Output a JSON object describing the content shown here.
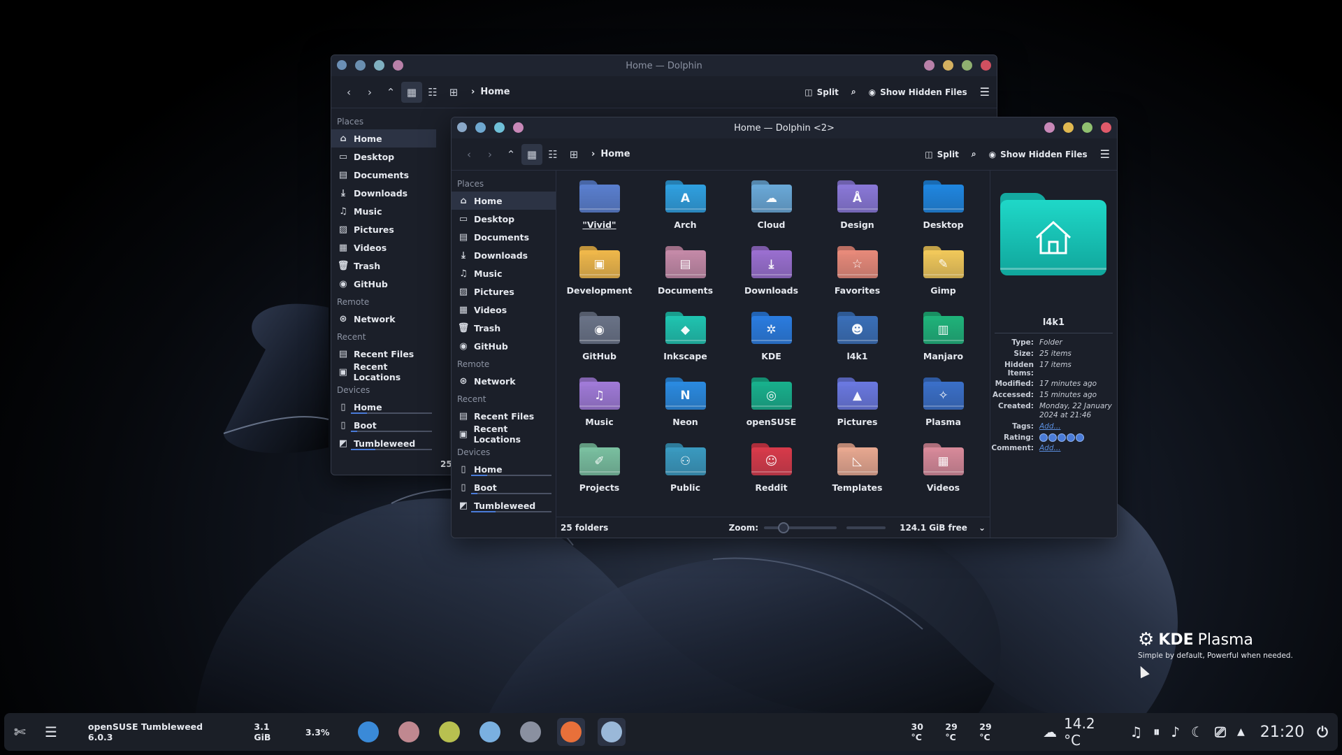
{
  "back_window": {
    "title": "Home — Dolphin",
    "breadcrumb": "Home",
    "split_label": "Split",
    "hidden_files_label": "Show Hidden Files",
    "status_partial": "25",
    "places_header": "Places",
    "places": [
      "Home",
      "Desktop",
      "Documents",
      "Downloads",
      "Music",
      "Pictures",
      "Videos",
      "Trash",
      "GitHub"
    ],
    "remote_header": "Remote",
    "remote": [
      "Network"
    ],
    "recent_header": "Recent",
    "recent": [
      "Recent Files",
      "Recent Locations"
    ],
    "devices_header": "Devices",
    "devices": [
      "Home",
      "Boot",
      "Tumbleweed"
    ],
    "title_dot_colors": [
      "#6b8fb5",
      "#6a8fb0",
      "#7fb0c0",
      "#b880a8"
    ],
    "right_dot_colors": [
      "#b880a8",
      "#d4b060",
      "#90b070",
      "#d05060"
    ]
  },
  "front_window": {
    "title": "Home — Dolphin <2>",
    "breadcrumb": "Home",
    "split_label": "Split",
    "hidden_files_label": "Show Hidden Files",
    "places_header": "Places",
    "places": [
      "Home",
      "Desktop",
      "Documents",
      "Downloads",
      "Music",
      "Pictures",
      "Videos",
      "Trash",
      "GitHub"
    ],
    "remote_header": "Remote",
    "remote": [
      "Network"
    ],
    "recent_header": "Recent",
    "recent": [
      "Recent Files",
      "Recent Locations"
    ],
    "devices_header": "Devices",
    "devices": [
      "Home",
      "Boot",
      "Tumbleweed"
    ],
    "device_usage": [
      0.2,
      0.08,
      0.3
    ],
    "folders": [
      {
        "name": "\"Vivid\"",
        "color": "#5a7fcf",
        "icon": "blank-folder"
      },
      {
        "name": "Arch",
        "color": "#2fa0e0",
        "icon": "arch-logo-icon",
        "glyph": "A"
      },
      {
        "name": "Cloud",
        "color": "#6aa9d8",
        "icon": "cloud-icon",
        "glyph": "☁"
      },
      {
        "name": "Design",
        "color": "#8a78d8",
        "icon": "design-icon",
        "glyph": "Å"
      },
      {
        "name": "Desktop",
        "color": "#1f86e0",
        "icon": "desktop-icon"
      },
      {
        "name": "Development",
        "color": "#f0b84a",
        "icon": "development-icon",
        "glyph": "▣"
      },
      {
        "name": "Documents",
        "color": "#c58aa8",
        "icon": "document-icon",
        "glyph": "▤"
      },
      {
        "name": "Downloads",
        "color": "#9a6fd0",
        "icon": "download-icon",
        "glyph": "⤓"
      },
      {
        "name": "Favorites",
        "color": "#e88a7a",
        "icon": "star-icon",
        "glyph": "☆"
      },
      {
        "name": "Gimp",
        "color": "#f2c95a",
        "icon": "gimp-icon",
        "glyph": "✎"
      },
      {
        "name": "GitHub",
        "color": "#6a7387",
        "icon": "github-icon",
        "glyph": "◉"
      },
      {
        "name": "Inkscape",
        "color": "#1fc4b0",
        "icon": "inkscape-icon",
        "glyph": "◆"
      },
      {
        "name": "KDE",
        "color": "#2a7ce0",
        "icon": "kde-icon",
        "glyph": "✲"
      },
      {
        "name": "l4k1",
        "color": "#3a6fb8",
        "icon": "avatar-icon",
        "glyph": "☻"
      },
      {
        "name": "Manjaro",
        "color": "#1fb37a",
        "icon": "manjaro-icon",
        "glyph": "▥"
      },
      {
        "name": "Music",
        "color": "#a07ad8",
        "icon": "music-icon",
        "glyph": "♫"
      },
      {
        "name": "Neon",
        "color": "#2a8ae0",
        "icon": "neon-icon",
        "glyph": "N"
      },
      {
        "name": "openSUSE",
        "color": "#18b08c",
        "icon": "opensuse-icon",
        "glyph": "◎"
      },
      {
        "name": "Pictures",
        "color": "#6a78e0",
        "icon": "pictures-icon",
        "glyph": "▲"
      },
      {
        "name": "Plasma",
        "color": "#3a6fc8",
        "icon": "plasma-icon",
        "glyph": "✧"
      },
      {
        "name": "Projects",
        "color": "#7ac0a0",
        "icon": "projects-icon",
        "glyph": "✐"
      },
      {
        "name": "Public",
        "color": "#3a9ac0",
        "icon": "public-icon",
        "glyph": "⚇"
      },
      {
        "name": "Reddit",
        "color": "#d83a4a",
        "icon": "reddit-icon",
        "glyph": "☺"
      },
      {
        "name": "Templates",
        "color": "#e8a890",
        "icon": "templates-icon",
        "glyph": "◺"
      },
      {
        "name": "Videos",
        "color": "#d88a9a",
        "icon": "video-icon",
        "glyph": "▦"
      }
    ],
    "status_count": "25 folders",
    "zoom_label": "Zoom:",
    "free_space": "124.1 GiB free",
    "info_panel": {
      "name": "l4k1",
      "rows": [
        {
          "k": "Type:",
          "v": "Folder"
        },
        {
          "k": "Size:",
          "v": "25 items"
        },
        {
          "k": "Hidden Items:",
          "v": "17 items"
        },
        {
          "k": "Modified:",
          "v": "17 minutes ago"
        },
        {
          "k": "Accessed:",
          "v": "15 minutes ago"
        },
        {
          "k": "Created:",
          "v": "Monday, 22 January 2024 at 21:46"
        }
      ],
      "tags_label": "Tags:",
      "tags_value": "Add...",
      "rating_label": "Rating:",
      "rating": 5,
      "comment_label": "Comment:",
      "comment_value": "Add..."
    },
    "title_dot_colors": [
      "#8aa8c8",
      "#6fa8d0",
      "#6fc0d8",
      "#c888b8"
    ],
    "right_dot_colors": [
      "#c888b8",
      "#e0b850",
      "#90c070",
      "#e05a6a"
    ]
  },
  "branding": {
    "title_bold": "KDE",
    "title_rest": "Plasma",
    "subtitle": "Simple by default, Powerful when  needed."
  },
  "panel": {
    "distro": "openSUSE Tumbleweed 6.0.3",
    "memory": "3.1 GiB",
    "cpu": "3.3%",
    "apps": [
      {
        "name": "monitor-app-icon",
        "color": "#3a8ad8"
      },
      {
        "name": "avatar-app-icon",
        "color": "#c08890"
      },
      {
        "name": "gecko-app-icon",
        "color": "#b8c050"
      },
      {
        "name": "sphere-app-icon",
        "color": "#7ab0e0"
      },
      {
        "name": "settings-app-icon",
        "color": "#8a90a0"
      },
      {
        "name": "firefox-app-icon",
        "color": "#e8703a"
      },
      {
        "name": "dolphin-app-icon",
        "color": "#9ab8d8"
      }
    ],
    "temps": [
      "30 °C",
      "29 °C",
      "29 °C"
    ],
    "weather_temp": "14.2 °C",
    "clock": "21:20"
  }
}
